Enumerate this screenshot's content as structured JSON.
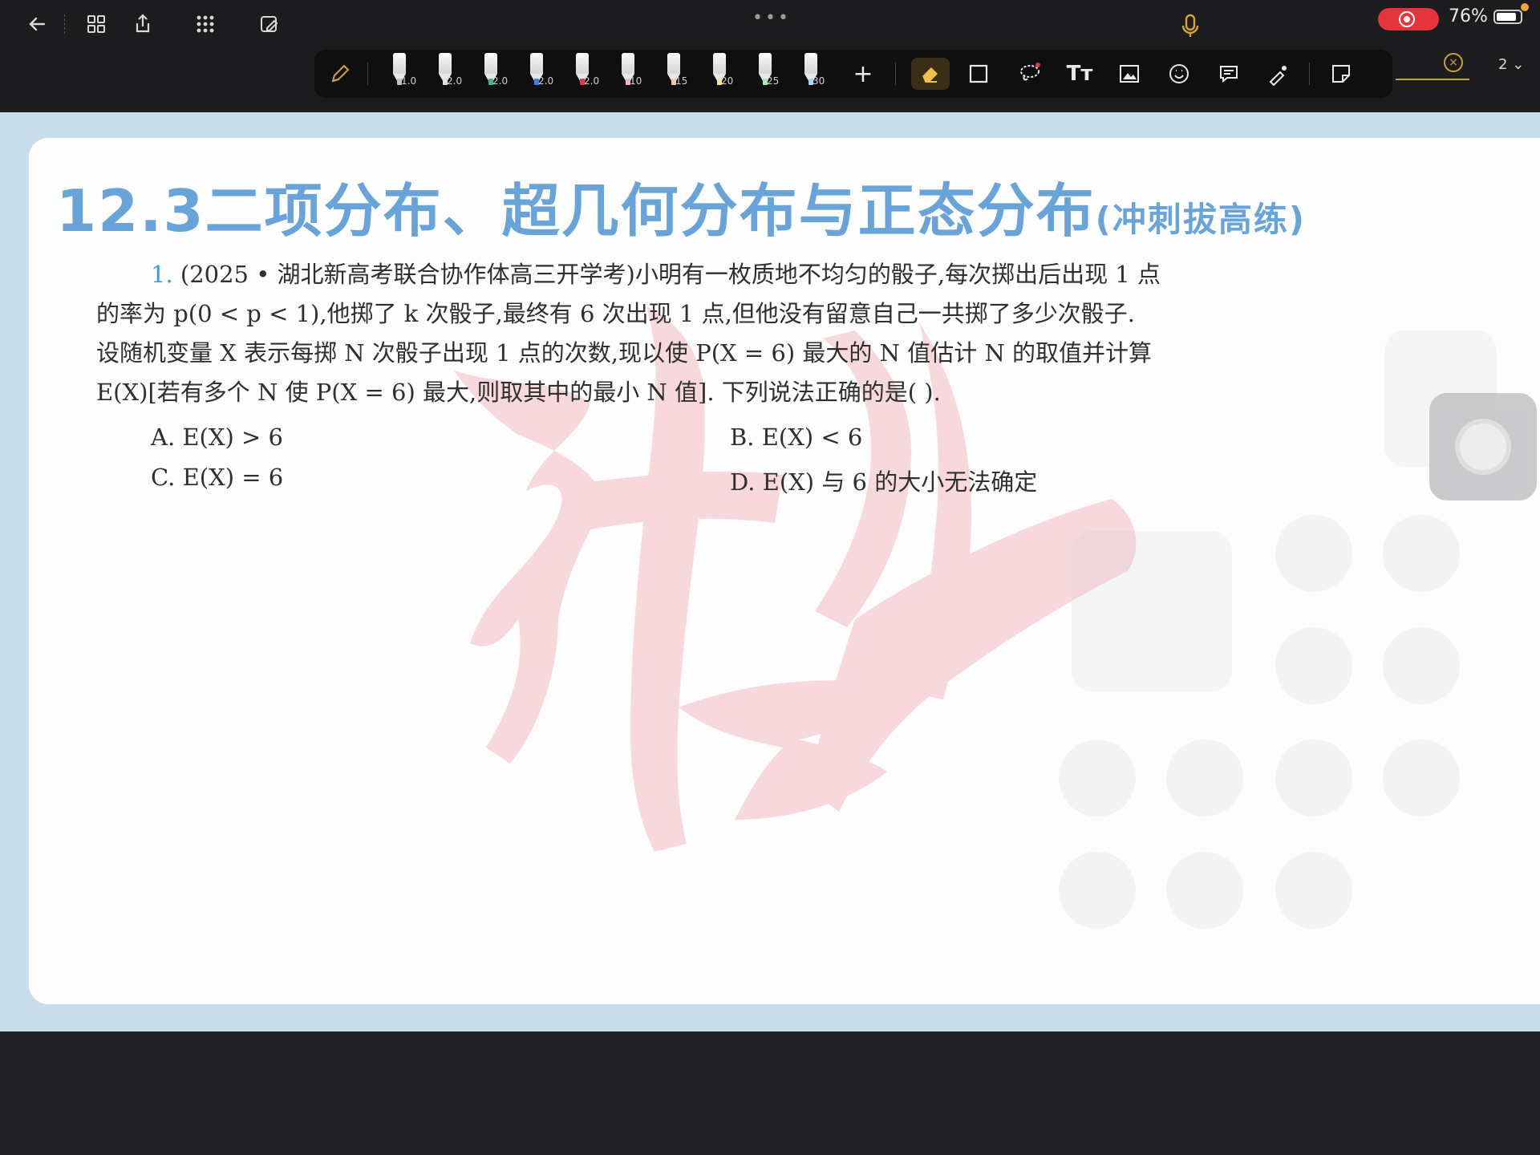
{
  "status": {
    "battery": "76%",
    "menu_dots": "•••"
  },
  "toolbar": {
    "pens": [
      {
        "size": "1.0",
        "color": "#d0d0d0"
      },
      {
        "size": "2.0",
        "color": "#e0e0e0"
      },
      {
        "size": "2.0",
        "color": "#39b39a"
      },
      {
        "size": "2.0",
        "color": "#3f7fd9"
      },
      {
        "size": "2.0",
        "color": "#e0394a"
      },
      {
        "size": "10",
        "color": "#f1b5c1"
      },
      {
        "size": "15",
        "color": "#f5c7a4"
      },
      {
        "size": "20",
        "color": "#f4e49a"
      },
      {
        "size": "25",
        "color": "#a7e3b6"
      },
      {
        "size": "30",
        "color": "#a9d6ef"
      }
    ],
    "add_label": "+",
    "text_tool_label": "Tт"
  },
  "page_selector": "2",
  "document": {
    "title_main": "12.3二项分布、超几何分布与正态分布",
    "title_sub": "(冲刺拔高练)",
    "question_number": "1.",
    "question_line1": "(2025 • 湖北新高考联合协作体高三开学考)小明有一枚质地不均匀的骰子,每次掷出后出现 1 点",
    "question_line2": "的率为 p(0 < p < 1),他掷了 k 次骰子,最终有 6 次出现 1 点,但他没有留意自己一共掷了多少次骰子.",
    "question_line3": "设随机变量 X 表示每掷 N 次骰子出现 1 点的次数,现以使 P(X = 6) 最大的 N 值估计 N 的取值并计算",
    "question_line4": "E(X)[若有多个 N 使 P(X = 6) 最大,则取其中的最小 N 值]. 下列说法正确的是(      ).",
    "options": {
      "a": "A.  E(X) > 6",
      "b": "B.  E(X) < 6",
      "c": "C.  E(X) = 6",
      "d": "D.  E(X) 与 6 的大小无法确定"
    }
  }
}
